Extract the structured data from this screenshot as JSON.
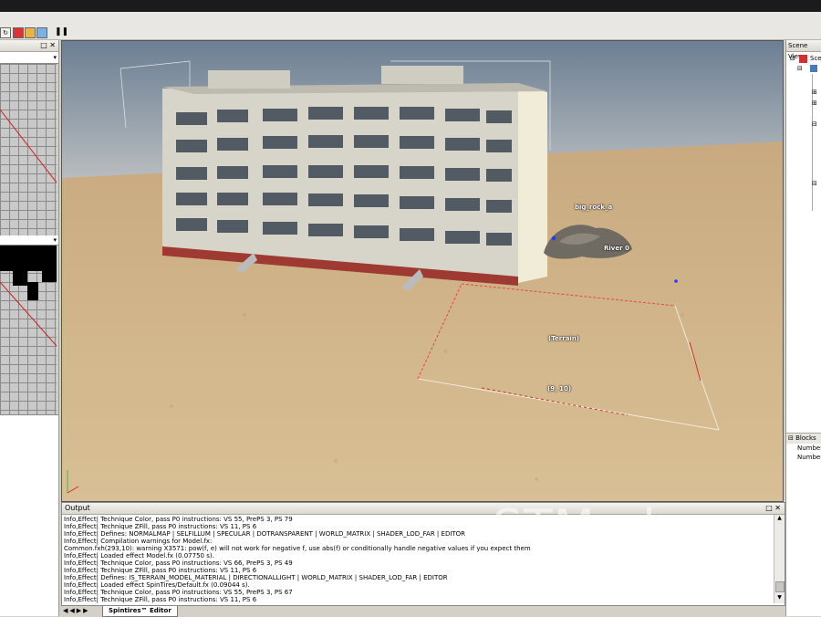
{
  "toolbar": {
    "buttons": [
      "refresh-icon",
      "red-box-icon",
      "folder-icon",
      "copy-icon",
      "pause-icon"
    ]
  },
  "left_panel": {
    "top_close_symbols": "p ×",
    "mid_close_symbols": "▾"
  },
  "viewport": {
    "labels": {
      "rock": "big_rock_a",
      "river": "River 0",
      "terrain": "(Terrain)",
      "coords": "(9, 10)"
    }
  },
  "output": {
    "title": "Output",
    "lines": [
      "Info,Effect| Technique Color, pass P0 instructions: VS 55, PrePS 3, PS 79",
      "Info,Effect| Technique ZFill, pass P0 instructions: VS 11, PS 6",
      "Info,Effect| Defines: NORMALMAP | SELFILLUM | SPECULAR | DOTRANSPARENT | WORLD_MATRIX | SHADER_LOD_FAR | EDITOR",
      "Info,Effect| Compilation warnings for Model.fx:",
      "Common.fxh(293,10): warning X3571: pow(f, e) will not work for negative f, use abs(f) or conditionally handle negative values if you expect them",
      "Info,Effect| Loaded effect Model.fx (0.07750 s).",
      "Info,Effect| Technique Color, pass P0 instructions: VS 66, PrePS 3, PS 49",
      "Info,Effect| Technique ZFill, pass P0 instructions: VS 11, PS 6",
      "Info,Effect| Defines: IS_TERRAIN_MODEL_MATERIAL | DIRECTIONALLIGHT | WORLD_MATRIX | SHADER_LOD_FAR | EDITOR",
      "Info,Effect| Loaded effect SpinTires/Default.fx (0.09044 s).",
      "Info,Effect| Technique Color, pass P0 instructions: VS 55, PrePS 3, PS 67",
      "Info,Effect| Technique ZFill, pass P0 instructions: VS 11, PS 6"
    ]
  },
  "tabs": {
    "active": "Spintires™ Editor"
  },
  "right_panel": {
    "scene_title": "Scene View",
    "scene_item": "Sce",
    "blocks_title": "Blocks",
    "number_1": "Number",
    "number_2": "Number"
  },
  "watermark": "STMods.ru",
  "colors": {
    "sky": "#6f8396",
    "sand": "#d2b48c",
    "building": "#d8d6cc",
    "selection": "#ff2a2a"
  }
}
